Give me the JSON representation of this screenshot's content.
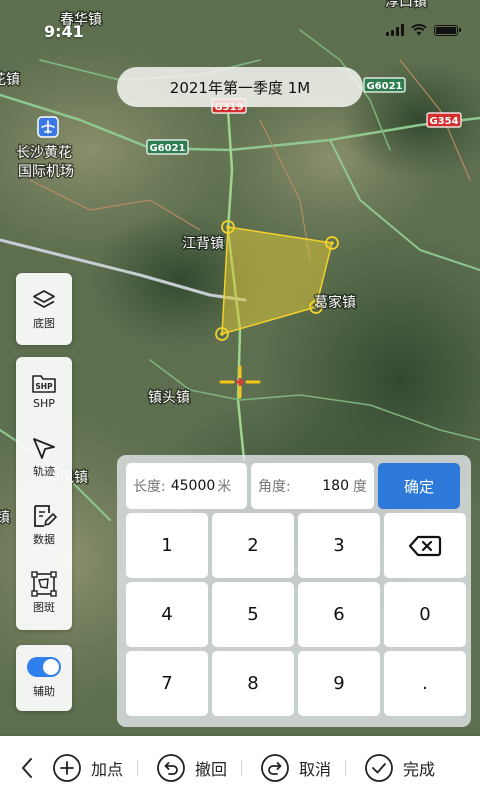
{
  "status_bar": {
    "time": "9:41"
  },
  "map": {
    "period_label": "2021年第一季度 1M",
    "place_labels": [
      {
        "name": "place-chunhua",
        "text": "春华镇"
      },
      {
        "name": "place-fuliu",
        "text": "淳口镇"
      },
      {
        "name": "place-left-town",
        "text": "花镇"
      },
      {
        "name": "place-airport",
        "text": "长沙黄花"
      },
      {
        "name": "place-airport-line2",
        "text": "国际机场"
      },
      {
        "name": "place-jiangbei",
        "text": "江背镇"
      },
      {
        "name": "place-gejia",
        "text": "葛家镇"
      },
      {
        "name": "place-zhentou",
        "text": "镇头镇"
      },
      {
        "name": "place-left-town2",
        "text": "凤镇"
      },
      {
        "name": "place-left-town3",
        "text": "镇"
      }
    ],
    "road_shields": [
      {
        "name": "road-shield-g6021-top",
        "text": "G6021",
        "kind": "highway"
      },
      {
        "name": "road-shield-g319",
        "text": "G319",
        "kind": "national"
      },
      {
        "name": "road-shield-g354",
        "text": "G354",
        "kind": "national"
      },
      {
        "name": "road-shield-g6021-left",
        "text": "G6021",
        "kind": "highway"
      }
    ],
    "polygon_color": "#d9c23a",
    "crosshair_color": "#f5c518"
  },
  "tools": {
    "basemap": {
      "label": "底图",
      "icon": "layers-icon"
    },
    "shp": {
      "label": "SHP",
      "icon": "shp-folder-icon"
    },
    "track": {
      "label": "轨迹",
      "icon": "navigation-arrow-icon"
    },
    "data": {
      "label": "数据",
      "icon": "edit-document-icon"
    },
    "patch": {
      "label": "图斑",
      "icon": "polygon-select-icon"
    },
    "assist": {
      "label": "辅助",
      "icon": "toggle-switch",
      "enabled": true
    }
  },
  "keypad": {
    "length_label": "长度:",
    "length_value": "45000",
    "length_unit": "米",
    "angle_label": "角度:",
    "angle_value": "180",
    "angle_unit": "度",
    "confirm_label": "确定",
    "digits": [
      "1",
      "2",
      "3",
      "4",
      "5",
      "6",
      "0",
      "7",
      "8",
      "9",
      "."
    ]
  },
  "bottom_bar": {
    "add_point": "加点",
    "undo": "撤回",
    "cancel": "取消",
    "done": "完成"
  }
}
